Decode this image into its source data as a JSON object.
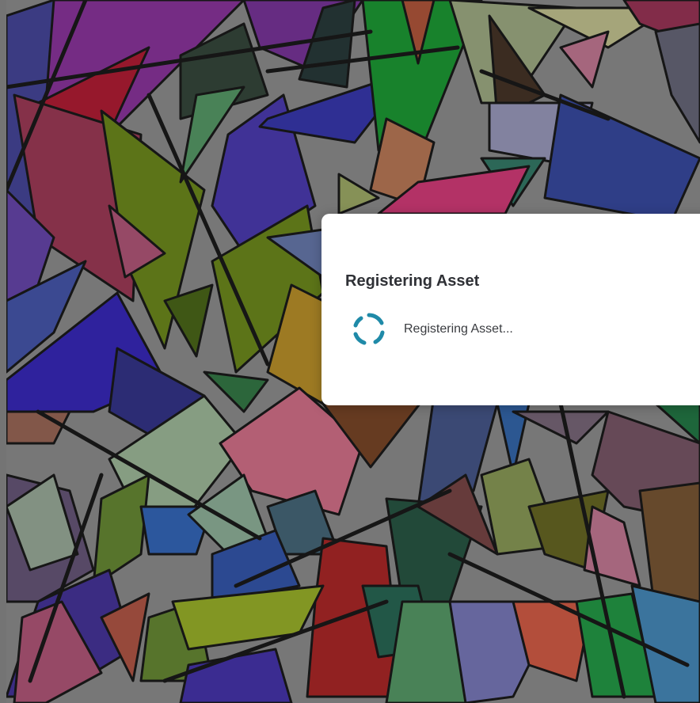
{
  "artwork": {
    "description_icon": "generative-polygon-artwork",
    "colors": [
      "#7b2a8c",
      "#a0142a",
      "#3b2a8f",
      "#5f7a14",
      "#8d2f4a",
      "#2a6b3a",
      "#2d3e9c",
      "#c0637a",
      "#6a3a1e",
      "#1f4a38",
      "#8e9a74",
      "#c6c76b",
      "#3a6a8a",
      "#9a2e1e",
      "#6f5a80",
      "#7fa08a",
      "#b06a84",
      "#4a6ad0",
      "#2a7a5a",
      "#a88020"
    ]
  },
  "modal": {
    "title": "Registering Asset",
    "status_text": "Registering Asset...",
    "spinner_icon": "loading-spinner-icon",
    "spinner_color": "#1f8aa8"
  }
}
